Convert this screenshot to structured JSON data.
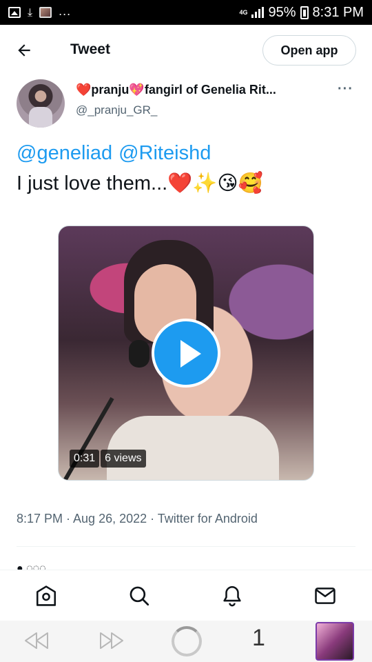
{
  "status_bar": {
    "network": "4G",
    "battery": "95%",
    "time": "8:31 PM",
    "overflow": "..."
  },
  "header": {
    "title": "Tweet",
    "open_app_label": "Open app"
  },
  "author": {
    "display_name": "❤️pranju💖fangirl of Genelia Rit...",
    "handle": "@_pranju_GR_",
    "more": "···"
  },
  "tweet": {
    "mentions": [
      "@geneliad",
      "@Riteishd"
    ],
    "text": "I just love them...",
    "emojis": "❤️✨😘🥰",
    "video": {
      "duration": "0:31",
      "views": "6 views"
    },
    "meta": "8:17 PM · Aug 26, 2022 · Twitter for Android"
  },
  "tabs": [
    "home-icon",
    "search-icon",
    "notifications-icon",
    "messages-icon"
  ],
  "browser": {
    "tab_count": "1"
  }
}
